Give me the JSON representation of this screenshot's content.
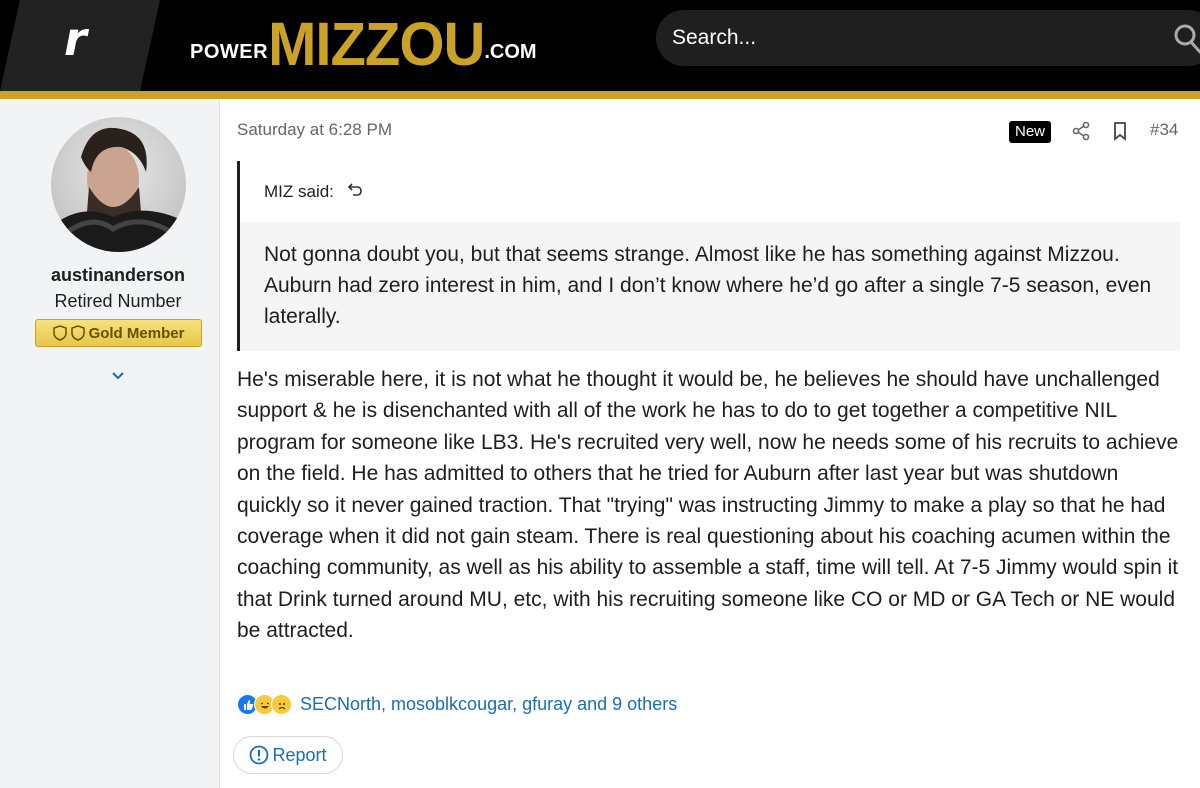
{
  "header": {
    "site_badge": "r",
    "logo_power": "POWER",
    "logo_mizzou": "MIZZOU",
    "logo_com": ".COM",
    "search_placeholder": "Search..."
  },
  "user": {
    "username": "austinanderson",
    "title": "Retired Number",
    "badge": "Gold Member"
  },
  "post": {
    "date": "Saturday at 6:28 PM",
    "new_badge": "New",
    "number": "#34",
    "quote_author": "MIZ said:",
    "quote_text": "Not gonna doubt you, but that seems strange. Almost like he has something against Mizzou. Auburn had zero interest in him, and I don’t know where he’d go after a single 7-5 season, even laterally.",
    "body": "He's miserable here, it is not what he thought it would be, he believes he should have unchallenged support & he is disenchanted with all of the work he has to do to get together a competitive NIL program for someone like LB3. He's recruited very well, now he needs some of his recruits to achieve on the field. He has admitted to others that he tried for Auburn after last year but was shutdown quickly so it never gained traction. That \"trying\" was instructing Jimmy to make a play so that he had coverage when it did not gain steam. There is real questioning about his coaching acumen within the coaching community, as well as his ability to assemble a staff, time will tell. At 7-5 Jimmy would spin it that Drink turned around MU, etc, with his recruiting someone like CO or MD or GA Tech or NE would be attracted.",
    "reactions_text": "SECNorth, mosoblkcougar, gfuray and 9 others",
    "reaction_icons": [
      "like-icon",
      "laugh-icon",
      "sad-icon"
    ],
    "report_label": "Report"
  },
  "colors": {
    "gold": "#c9a227",
    "link": "#1a6db5",
    "header_bg": "#000000"
  }
}
